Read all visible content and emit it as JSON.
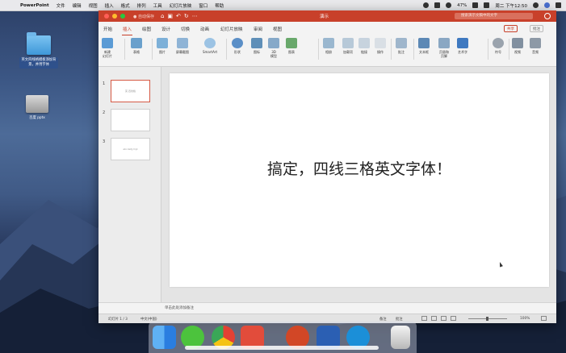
{
  "menubar": {
    "app": "PowerPoint",
    "items": [
      "文件",
      "编辑",
      "视图",
      "插入",
      "格式",
      "排列",
      "工具",
      "幻灯片放映",
      "窗口",
      "帮助"
    ],
    "battery": "47%",
    "clock": "周二 下午12:50"
  },
  "desktop": {
    "icons": [
      {
        "label": "英文四线格模板添加背景，并用字体"
      },
      {
        "label": "百度 pptx"
      }
    ]
  },
  "window": {
    "autosave": "● 自动保存",
    "document_title": "演示",
    "search_placeholder": "搜索演示文稿中的文字",
    "tabs": [
      "开始",
      "插入",
      "绘图",
      "设计",
      "切换",
      "动画",
      "幻灯片放映",
      "审阅",
      "视图"
    ],
    "active_tab": "插入",
    "share": "共享",
    "comments": "批注",
    "ribbon": [
      "新建\n幻灯片",
      "表格",
      "图片",
      "屏幕截图",
      "SmartArt",
      "形状",
      "图标",
      "3D\n模型",
      "图表",
      "相册",
      "加载项",
      "链接",
      "操作",
      "批注",
      "文本框",
      "页眉和\n页脚",
      "艺术字",
      "符号",
      "视频",
      "音频"
    ],
    "thumbnails": [
      {
        "number": "1",
        "text": "英 四线格"
      },
      {
        "number": "2",
        "text": ""
      },
      {
        "number": "3",
        "text": "abcdefg hijk"
      }
    ],
    "slide_text": "搞定，四线三格英文字体！",
    "notes_placeholder": "单击此处添加备注",
    "status": {
      "slide_info": "幻灯片 1 / 3",
      "language": "中文(中国)",
      "notes": "备注",
      "comments": "批注",
      "zoom": "100%"
    }
  },
  "colors": {
    "accent": "#c8402a"
  },
  "dock": {
    "apps": [
      "finder-icon",
      "wechat-icon",
      "chrome-icon",
      "pdf-icon",
      "powerpoint-icon",
      "word-icon",
      "safari-icon",
      "trash-icon"
    ]
  }
}
